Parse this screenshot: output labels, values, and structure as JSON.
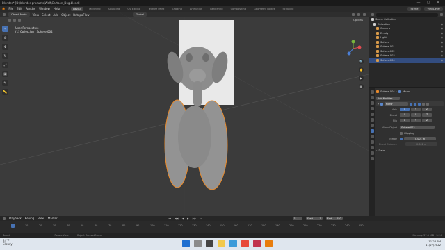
{
  "titlebar": {
    "title": "Blender* [D:\\blender products\\Wolf\\Cartoon_Dog.blend]",
    "min": "—",
    "max": "▢",
    "close": "✕"
  },
  "menubar": {
    "items": [
      "File",
      "Edit",
      "Render",
      "Window",
      "Help"
    ],
    "workspaces": [
      "Layout",
      "Modeling",
      "Sculpting",
      "UV Editing",
      "Texture Paint",
      "Shading",
      "Animation",
      "Rendering",
      "Compositing",
      "Geometry Nodes",
      "Scripting"
    ],
    "active_workspace": "Layout",
    "scene": "Scene",
    "view_layer": "ViewLayer"
  },
  "viewport": {
    "mode": "Object Mode",
    "menus": [
      "View",
      "Select",
      "Add",
      "Object"
    ],
    "retopoflow": "RetopoFlow",
    "orientation": "Global",
    "options": "Options",
    "info_line1": "User Perspective",
    "info_line2": "(1) Collection | Sphere.004"
  },
  "outliner": {
    "header": "Scene Collection",
    "items": [
      {
        "label": "Collection",
        "color": "#cfcfcf"
      },
      {
        "label": "Camera",
        "color": "#d99b4a"
      },
      {
        "label": "Empty",
        "color": "#d99b4a"
      },
      {
        "label": "Light",
        "color": "#d99b4a"
      },
      {
        "label": "Sphere",
        "color": "#d99b4a"
      },
      {
        "label": "Sphere.001",
        "color": "#d99b4a"
      },
      {
        "label": "Sphere.002",
        "color": "#d99b4a"
      },
      {
        "label": "Sphere.003",
        "color": "#d99b4a"
      },
      {
        "label": "Sphere.004",
        "color": "#d99b4a"
      }
    ],
    "selected": "Sphere.004"
  },
  "properties": {
    "object": "Sphere.004",
    "modifier_name_header": "Mirror",
    "add_modifier": "Add Modifier",
    "modifier": "Mirror",
    "axis_label": "Axis",
    "bisect_label": "Bisect",
    "flip_label": "Flip",
    "axes": [
      "X",
      "Y",
      "Z"
    ],
    "mirror_object_label": "Mirror Object",
    "mirror_object": "Sphere.003",
    "clipping": "Clipping",
    "merge_label": "Merge",
    "merge_value": "0.001 m",
    "bisect_distance_label": "Bisect Distance",
    "bisect_distance_value": "0.001 m",
    "data": "Data"
  },
  "timeline": {
    "menus": [
      "Playback",
      "Keying",
      "View",
      "Marker"
    ],
    "current_frame": "1",
    "start_label": "Start",
    "start": "1",
    "end_label": "End",
    "end": "250",
    "ticks": [
      "1",
      "10",
      "20",
      "30",
      "40",
      "50",
      "60",
      "70",
      "80",
      "90",
      "100",
      "110",
      "120",
      "130",
      "140",
      "150",
      "160",
      "170",
      "180",
      "190",
      "200",
      "210",
      "220",
      "230",
      "240",
      "250"
    ]
  },
  "statusbar": {
    "left": "Select",
    "mid1": "Rotate View",
    "mid2": "Object Context Menu",
    "version": "Memory: 57.4 MiB | 3.2.0"
  },
  "taskbar": {
    "weather_temp": "24°F",
    "weather_desc": "Cloudy",
    "time": "11:28 PM",
    "date": "11/27/2022"
  }
}
